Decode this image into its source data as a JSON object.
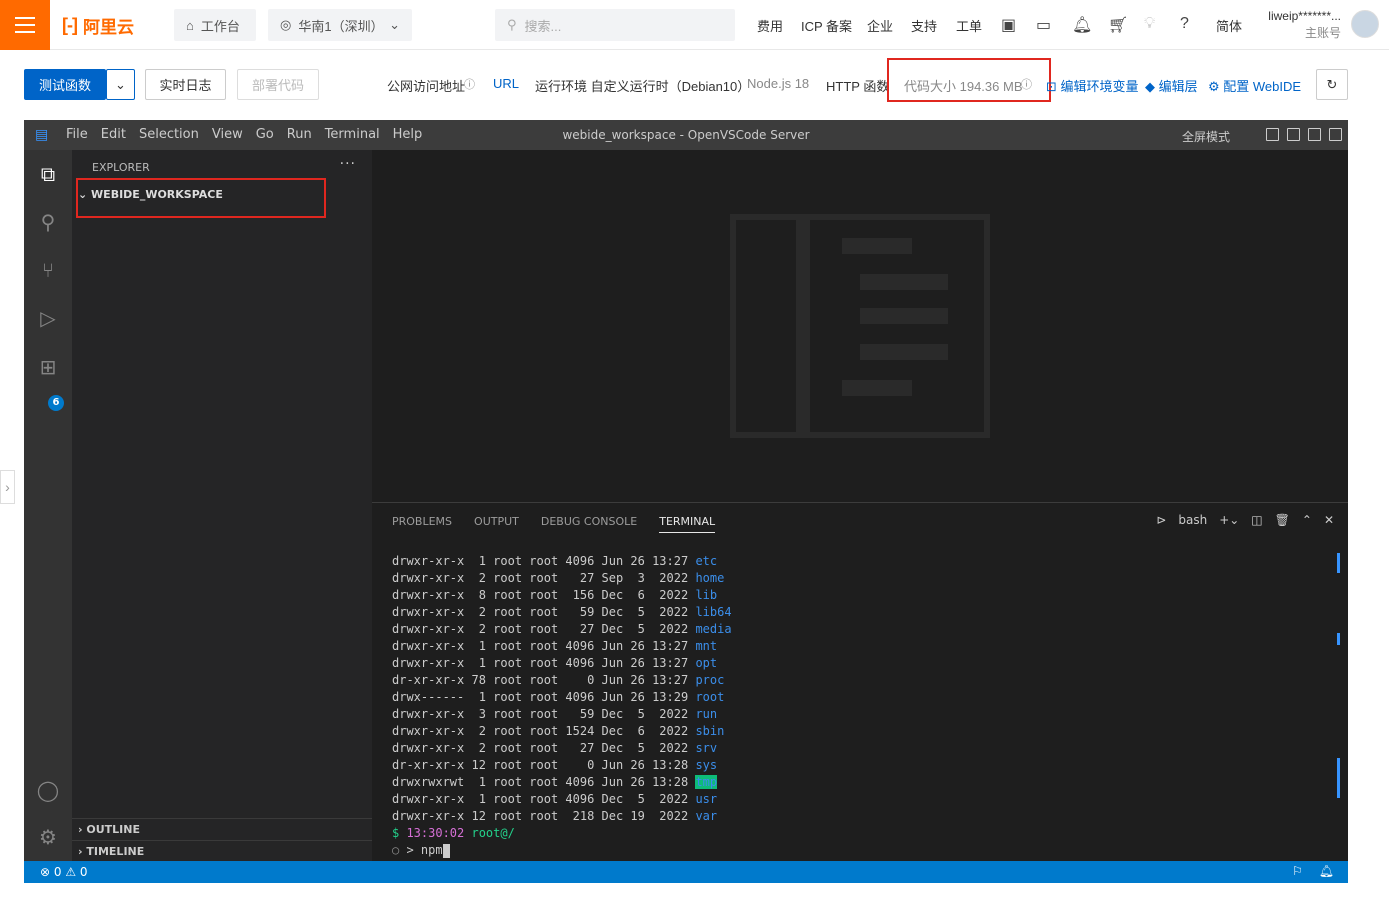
{
  "topnav": {
    "logo_text": "阿里云",
    "workspace": "工作台",
    "region": "华南1（深圳）",
    "search_placeholder": "搜索...",
    "links": [
      "费用",
      "ICP 备案",
      "企业",
      "支持",
      "工单"
    ],
    "lang": "简体",
    "user_name": "liweip*******...",
    "user_role": "主账号"
  },
  "toolbar": {
    "test_label": "测试函数",
    "log_label": "实时日志",
    "deploy_label": "部署代码",
    "public_url_label": "公网访问地址",
    "url_label": "URL",
    "runtime_label": "运行环境 自定义运行时（Debian10）",
    "node_label": "Node.js 18",
    "http_label": "HTTP 函数",
    "code_size_label": "代码大小 194.36 MB",
    "edit_env_label": "编辑环境变量",
    "edit_layer_label": "编辑层",
    "config_webide_label": "配置 WebIDE"
  },
  "ide": {
    "menu": [
      "File",
      "Edit",
      "Selection",
      "View",
      "Go",
      "Run",
      "Terminal",
      "Help"
    ],
    "window_title": "webide_workspace - OpenVSCode Server",
    "fullscreen_label": "全屏模式",
    "explorer_label": "EXPLORER",
    "workspace_name": "WEBIDE_WORKSPACE",
    "outline_label": "OUTLINE",
    "timeline_label": "TIMELINE",
    "extensions_badge": "6",
    "panel_tabs": [
      "PROBLEMS",
      "OUTPUT",
      "DEBUG CONSOLE",
      "TERMINAL"
    ],
    "shell_label": "bash",
    "status_left": "⊗ 0 ⚠ 0"
  },
  "terminal": {
    "rows": [
      {
        "perm": "drwxr-xr-x",
        "links": " 1",
        "size": "4096",
        "mon": "Jun",
        "day": "26",
        "time": "13:27",
        "name": "etc"
      },
      {
        "perm": "drwxr-xr-x",
        "links": " 2",
        "size": "  27",
        "mon": "Sep",
        "day": " 3",
        "time": " 2022",
        "name": "home"
      },
      {
        "perm": "drwxr-xr-x",
        "links": " 8",
        "size": " 156",
        "mon": "Dec",
        "day": " 6",
        "time": " 2022",
        "name": "lib"
      },
      {
        "perm": "drwxr-xr-x",
        "links": " 2",
        "size": "  59",
        "mon": "Dec",
        "day": " 5",
        "time": " 2022",
        "name": "lib64"
      },
      {
        "perm": "drwxr-xr-x",
        "links": " 2",
        "size": "  27",
        "mon": "Dec",
        "day": " 5",
        "time": " 2022",
        "name": "media"
      },
      {
        "perm": "drwxr-xr-x",
        "links": " 1",
        "size": "4096",
        "mon": "Jun",
        "day": "26",
        "time": "13:27",
        "name": "mnt"
      },
      {
        "perm": "drwxr-xr-x",
        "links": " 1",
        "size": "4096",
        "mon": "Jun",
        "day": "26",
        "time": "13:27",
        "name": "opt"
      },
      {
        "perm": "dr-xr-xr-x",
        "links": "78",
        "size": "   0",
        "mon": "Jun",
        "day": "26",
        "time": "13:27",
        "name": "proc"
      },
      {
        "perm": "drwx------",
        "links": " 1",
        "size": "4096",
        "mon": "Jun",
        "day": "26",
        "time": "13:29",
        "name": "root"
      },
      {
        "perm": "drwxr-xr-x",
        "links": " 3",
        "size": "  59",
        "mon": "Dec",
        "day": " 5",
        "time": " 2022",
        "name": "run"
      },
      {
        "perm": "drwxr-xr-x",
        "links": " 2",
        "size": "1524",
        "mon": "Dec",
        "day": " 6",
        "time": " 2022",
        "name": "sbin"
      },
      {
        "perm": "drwxr-xr-x",
        "links": " 2",
        "size": "  27",
        "mon": "Dec",
        "day": " 5",
        "time": " 2022",
        "name": "srv"
      },
      {
        "perm": "dr-xr-xr-x",
        "links": "12",
        "size": "   0",
        "mon": "Jun",
        "day": "26",
        "time": "13:28",
        "name": "sys"
      },
      {
        "perm": "drwxrwxrwt",
        "links": " 1",
        "size": "4096",
        "mon": "Jun",
        "day": "26",
        "time": "13:28",
        "name": "tmp",
        "highlight": true
      },
      {
        "perm": "drwxr-xr-x",
        "links": " 1",
        "size": "4096",
        "mon": "Dec",
        "day": " 5",
        "time": " 2022",
        "name": "usr"
      },
      {
        "perm": "drwxr-xr-x",
        "links": "12",
        "size": " 218",
        "mon": "Dec",
        "day": "19",
        "time": " 2022",
        "name": "var"
      }
    ],
    "prompt_time": "13:30:02",
    "prompt_user": "root@/",
    "input": "npm"
  },
  "colors": {
    "accent": "#ff6a00",
    "primary": "#0064c8",
    "ide_status": "#007acc"
  }
}
